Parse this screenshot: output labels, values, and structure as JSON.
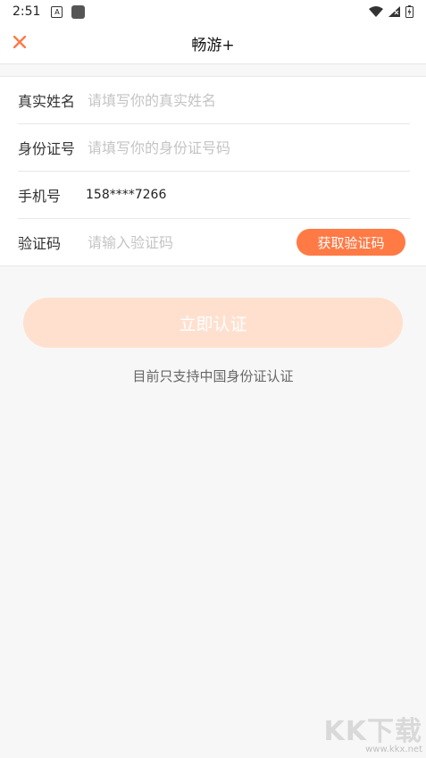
{
  "status_bar": {
    "time": "2:51",
    "icon_a_label": "A"
  },
  "app_bar": {
    "title": "畅游+"
  },
  "form": {
    "name": {
      "label": "真实姓名",
      "placeholder": "请填写你的真实姓名"
    },
    "id_number": {
      "label": "身份证号",
      "placeholder": "请填写你的身份证号码"
    },
    "phone": {
      "label": "手机号",
      "value": "158****7266"
    },
    "code": {
      "label": "验证码",
      "placeholder": "请输入验证码",
      "button": "获取验证码"
    }
  },
  "submit_label": "立即认证",
  "note": "目前只支持中国身份证认证",
  "watermark": {
    "logo": "KK下载",
    "url": "www.kkx.net"
  },
  "colors": {
    "accent": "#ff7a45",
    "submit_disabled": "#ffe0cf"
  }
}
